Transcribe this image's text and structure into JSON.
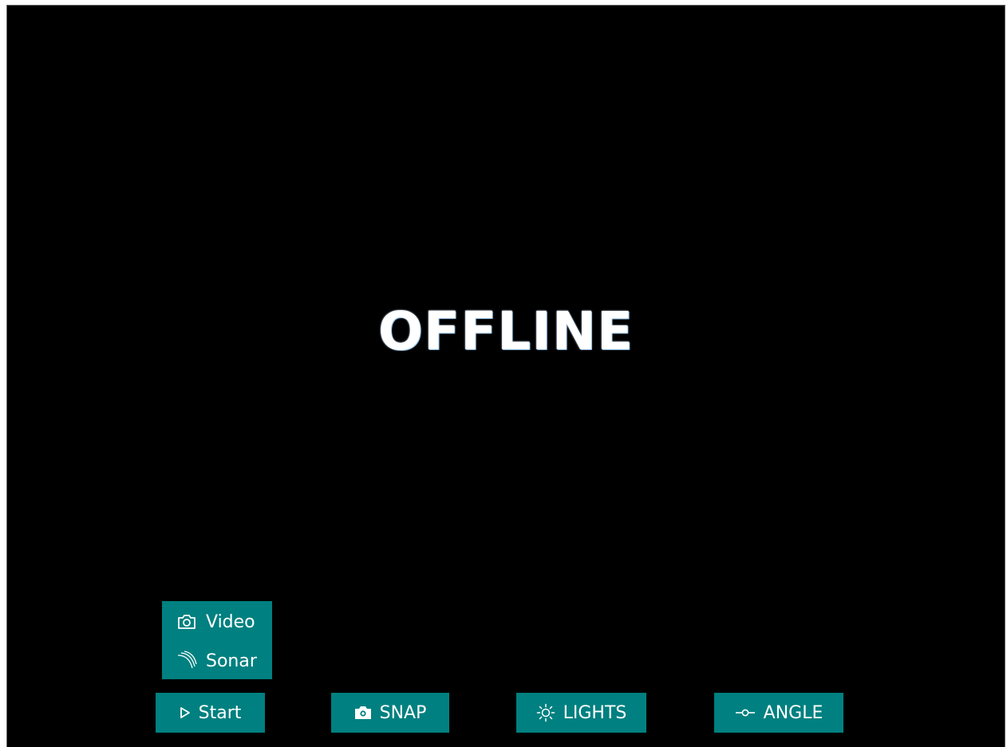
{
  "status": {
    "text": "OFFLINE"
  },
  "source_menu": {
    "items": [
      {
        "label": "Video",
        "icon": "camera-outline-icon"
      },
      {
        "label": "Sonar",
        "icon": "sonar-arc-icon"
      }
    ]
  },
  "controls": {
    "start": {
      "label": "Start",
      "icon": "play-icon"
    },
    "snap": {
      "label": "SNAP",
      "icon": "camera-filled-icon"
    },
    "lights": {
      "label": "LIGHTS",
      "icon": "sun-icon"
    },
    "angle": {
      "label": "ANGLE",
      "icon": "angle-slider-icon"
    }
  },
  "colors": {
    "button_bg": "#008080",
    "viewport_bg": "#000000",
    "text": "#ffffff"
  }
}
